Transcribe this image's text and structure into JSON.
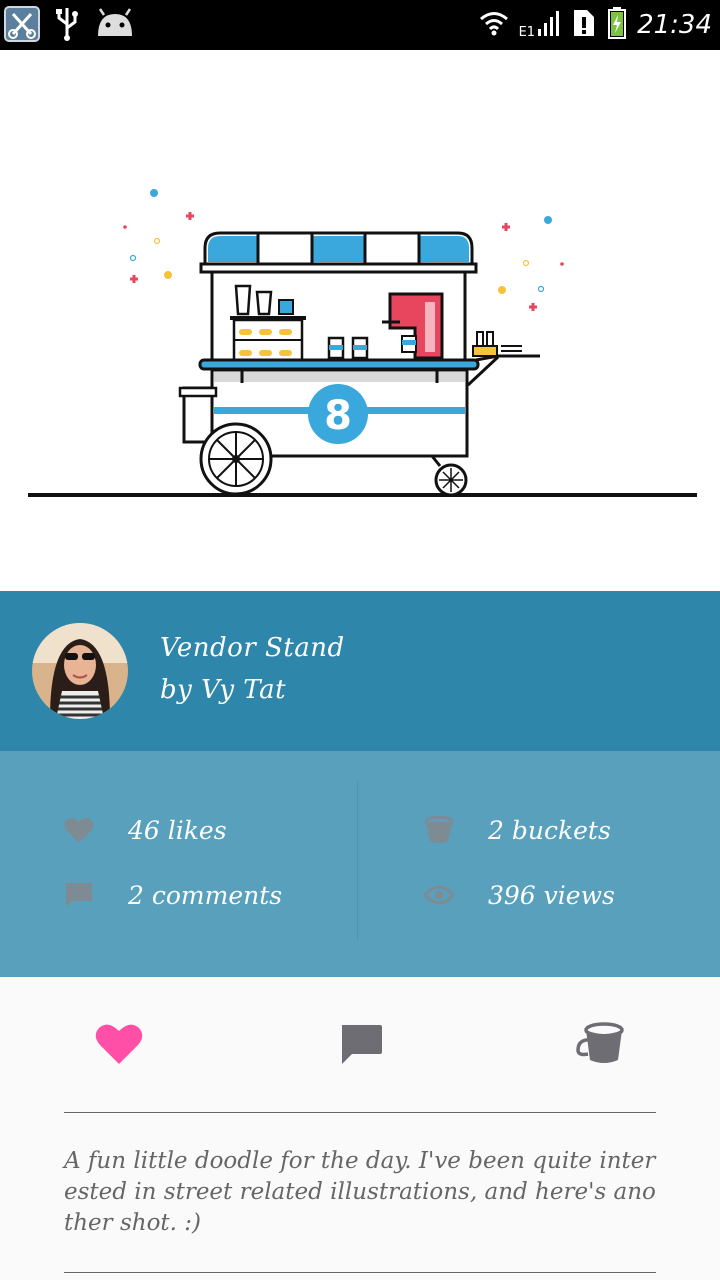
{
  "status_bar": {
    "time": "21:34",
    "network_label": "E1",
    "icons": [
      "app-scissors-icon",
      "usb-icon",
      "android-icon",
      "wifi-icon",
      "signal-icon",
      "sim-alert-icon",
      "battery-charging-icon"
    ]
  },
  "shot": {
    "title": "Vendor Stand",
    "author_line": "by Vy Tat",
    "badge_number": "8",
    "illustration": "vendor-cart-illustration"
  },
  "stats": {
    "likes": "46 likes",
    "buckets": "2 buckets",
    "comments": "2 comments",
    "views": "396 views"
  },
  "actions": {
    "like_color": "#ff4fa7",
    "icon_color": "#6d6d73",
    "items": [
      "like-icon",
      "comment-icon",
      "bucket-icon"
    ]
  },
  "description": "A fun little doodle for the day. I've been quite interested in street related illustrations, and here's another shot. :)",
  "colors": {
    "author_bar": "#2e86ab",
    "stats_panel": "#58a0bc",
    "status_bar": "#000000"
  }
}
